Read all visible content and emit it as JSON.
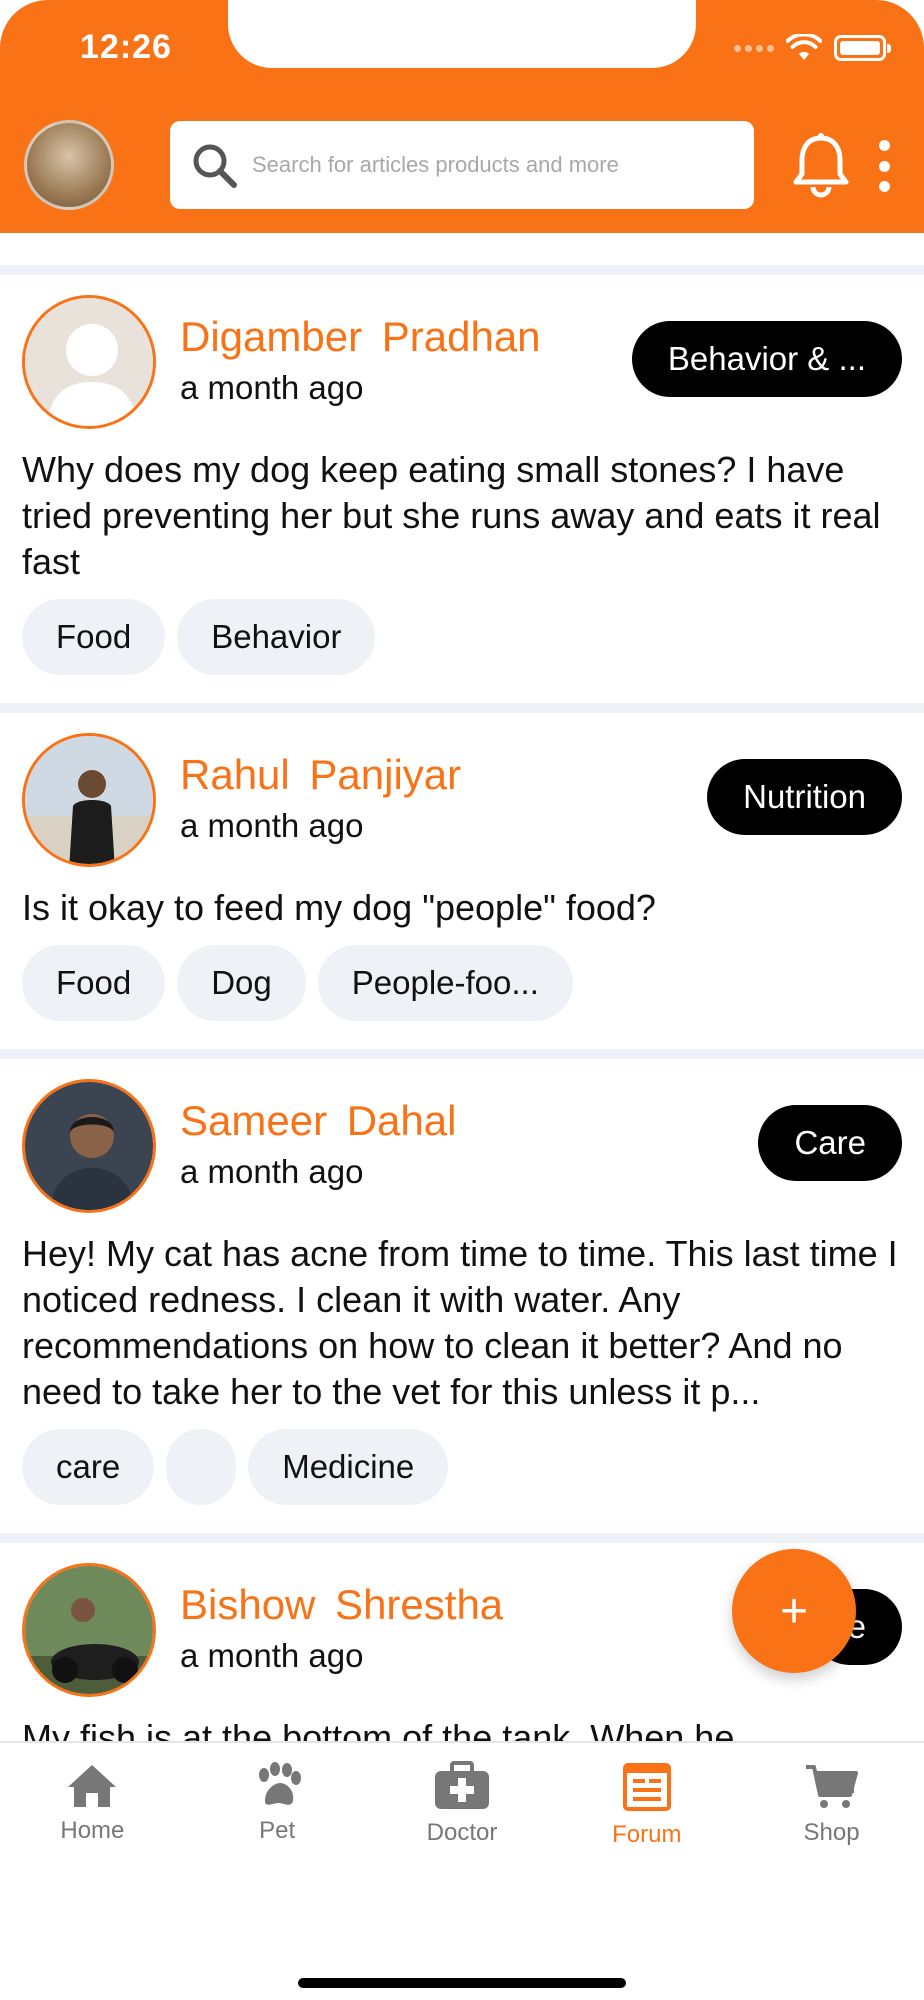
{
  "status_bar": {
    "time": "12:26"
  },
  "header": {
    "search_placeholder": "Search for articles products and more",
    "avatar_icon": "profile-avatar",
    "bell_icon": "bell-icon",
    "menu_icon": "kebab-menu-icon"
  },
  "posts": [
    {
      "author": "Digamber  Pradhan",
      "time": "a month ago",
      "category": "Behavior & ...",
      "question": "Why does my dog keep eating small stones? I have tried preventing her but she runs away and eats it real fast",
      "tags": [
        "Food",
        "Behavior"
      ]
    },
    {
      "author": "Rahul  Panjiyar",
      "time": "a month ago",
      "category": "Nutrition",
      "question": "Is it okay to feed my dog \"people\" food?",
      "tags": [
        "Food",
        "Dog",
        "People-foo..."
      ]
    },
    {
      "author": "Sameer  Dahal",
      "time": "a month ago",
      "category": "Care",
      "question": "Hey! My cat has acne from time to time. This last time I noticed redness. I clean it with water. Any recommendations on how to clean it better? And no need to take her to the vet for this unless it p...",
      "tags": [
        "care",
        "",
        "Medicine"
      ]
    },
    {
      "author": "Bishow  Shrestha",
      "time": "a month ago",
      "category": "e",
      "question": "My fish is at the bottom of the tank. When he",
      "tags": []
    }
  ],
  "fab": {
    "label": "+"
  },
  "nav": {
    "items": [
      {
        "label": "Home",
        "icon": "home-icon"
      },
      {
        "label": "Pet",
        "icon": "paw-icon"
      },
      {
        "label": "Doctor",
        "icon": "medical-kit-icon"
      },
      {
        "label": "Forum",
        "icon": "forum-icon"
      },
      {
        "label": "Shop",
        "icon": "cart-icon"
      }
    ],
    "active": "Forum"
  },
  "colors": {
    "accent": "#F97316",
    "tag_bg": "#EEF2F6",
    "category_bg": "#000000"
  }
}
